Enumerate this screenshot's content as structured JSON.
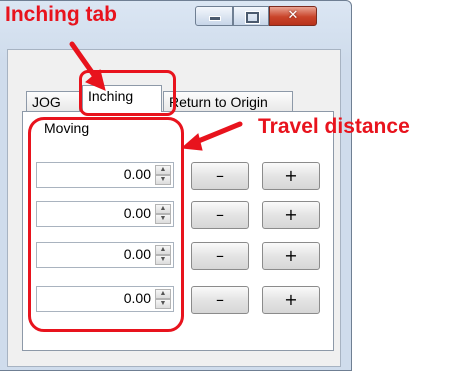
{
  "window": {
    "close_glyph": "✕"
  },
  "tabs": [
    {
      "label": "JOG",
      "selected": false
    },
    {
      "label": "Inching",
      "selected": true
    },
    {
      "label": "Return to Origin",
      "selected": false
    }
  ],
  "panel": {
    "moving_label": "Moving",
    "rows": [
      {
        "value": "0.00",
        "minus_label": "–",
        "plus_label": "+"
      },
      {
        "value": "0.00",
        "minus_label": "–",
        "plus_label": "+"
      },
      {
        "value": "0.00",
        "minus_label": "–",
        "plus_label": "+"
      },
      {
        "value": "0.00",
        "minus_label": "–",
        "plus_label": "+"
      }
    ]
  },
  "annotations": {
    "inching_tab": "Inching tab",
    "travel_distance": "Travel distance",
    "color": "#e8131d"
  },
  "icons": {
    "spin_up": "▲",
    "spin_down": "▼"
  }
}
